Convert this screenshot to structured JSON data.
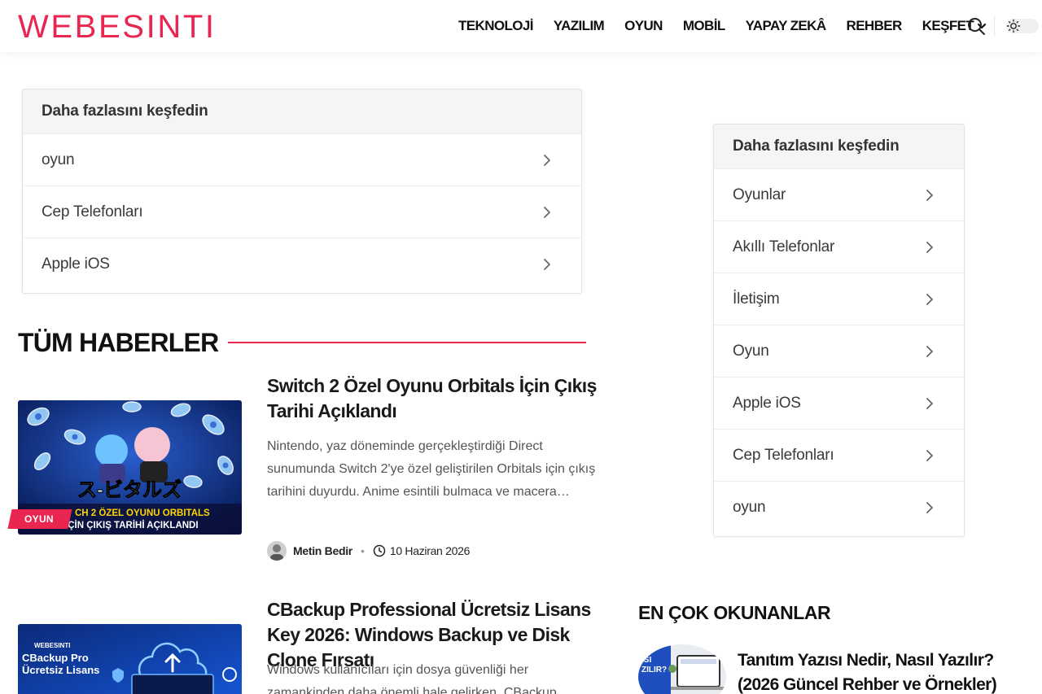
{
  "site": {
    "logo_text": "WEBESINTI",
    "brand_color": "#e8264f"
  },
  "nav": {
    "items": [
      "TEKNOLOJİ",
      "YAZILIM",
      "OYUN",
      "MOBİL",
      "YAPAY ZEKÂ",
      "REHBER",
      "KEŞFET"
    ],
    "search_icon": "search-icon",
    "theme_icon": "sun-icon"
  },
  "explore_main": {
    "title": "Daha fazlasını keşfedin",
    "items": [
      "oyun",
      "Cep Telefonları",
      "Apple iOS"
    ]
  },
  "explore_sidebar": {
    "title": "Daha fazlasını keşfedin",
    "items": [
      "Oyunlar",
      "Akıllı Telefonlar",
      "İletişim",
      "Oyun",
      "Apple iOS",
      "Cep Telefonları",
      "oyun"
    ]
  },
  "section": {
    "title": "TÜM HABERLER"
  },
  "posts": [
    {
      "category": "OYUN",
      "thumb_caption_1": "CH 2 ÖZEL OYUNU ORBITALS",
      "thumb_caption_2": "İÇİN ÇIKIŞ TARİHİ AÇIKLANDI",
      "title": "Switch 2 Özel Oyunu Orbitals İçin Çıkış Tarihi Açıklandı",
      "excerpt": "Nintendo, yaz döneminde gerçekleştirdiği Direct sunumunda Switch 2'ye özel geliştirilen Orbitals için çıkış tarihini duyurdu. Anime esintili bulmaca ve macera…",
      "author": "Metin Bedir",
      "date": "10 Haziran 2026"
    },
    {
      "thumb_brand": "WEBESINTI",
      "thumb_caption_1": "CBackup Pro",
      "thumb_caption_2": "Ücretsiz Lisans",
      "title": "CBackup Professional Ücretsiz Lisans Key 2026: Windows Backup ve Disk Clone Fırsatı",
      "excerpt": "Windows kullanıcıları için dosya güvenliği her zamankinden daha önemli hale gelirken, CBackup"
    }
  ],
  "popular": {
    "title": "EN ÇOK OKUNANLAR",
    "items": [
      {
        "title": "Tanıtım Yazısı Nedir, Nasıl Yazılır? (2026 Güncel Rehber ve Örnekler)",
        "thumb_text": "ISI\nZILIR?"
      }
    ]
  }
}
